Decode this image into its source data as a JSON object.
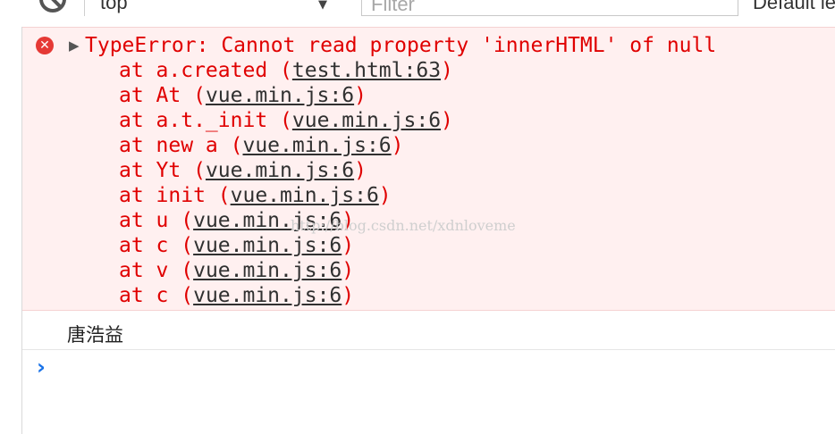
{
  "toolbar": {
    "context": "top",
    "filter_placeholder": "Filter",
    "levels": "Default levels"
  },
  "error": {
    "message": "TypeError: Cannot read property 'innerHTML' of null",
    "stack": [
      {
        "prefix": "at a.created (",
        "link": "test.html:63",
        "suffix": ")"
      },
      {
        "prefix": "at At (",
        "link": "vue.min.js:6",
        "suffix": ")"
      },
      {
        "prefix": "at a.t._init (",
        "link": "vue.min.js:6",
        "suffix": ")"
      },
      {
        "prefix": "at new a (",
        "link": "vue.min.js:6",
        "suffix": ")"
      },
      {
        "prefix": "at Yt (",
        "link": "vue.min.js:6",
        "suffix": ")"
      },
      {
        "prefix": "at init (",
        "link": "vue.min.js:6",
        "suffix": ")"
      },
      {
        "prefix": "at u (",
        "link": "vue.min.js:6",
        "suffix": ")"
      },
      {
        "prefix": "at c (",
        "link": "vue.min.js:6",
        "suffix": ")"
      },
      {
        "prefix": "at v (",
        "link": "vue.min.js:6",
        "suffix": ")"
      },
      {
        "prefix": "at c (",
        "link": "vue.min.js:6",
        "suffix": ")"
      }
    ]
  },
  "log": {
    "text": "唐浩益"
  },
  "watermark": "http://blog.csdn.net/xdnloveme",
  "icons": {
    "block": "block-icon",
    "error": "error-icon",
    "expand": "expand-triangle-icon",
    "prompt": "prompt-chevron-icon"
  },
  "colors": {
    "error_text": "#e00000",
    "error_bg": "#fff0f0",
    "prompt": "#1a73e8"
  }
}
